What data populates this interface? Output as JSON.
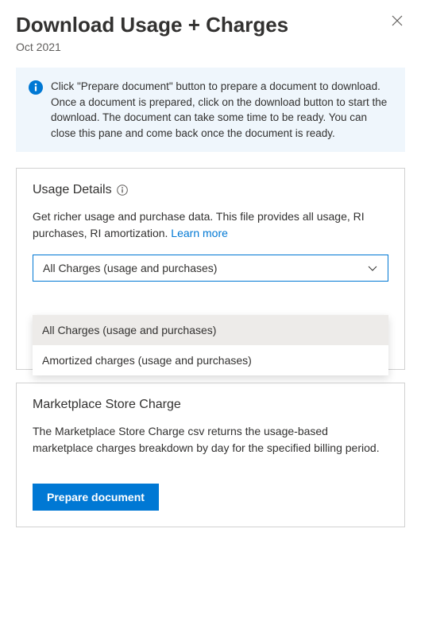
{
  "header": {
    "title": "Download Usage + Charges",
    "subtitle": "Oct 2021"
  },
  "info_banner": {
    "text": "Click \"Prepare document\" button to prepare a document to download. Once a document is prepared, click on the download button to start the download. The document can take some time to be ready. You can close this pane and come back once the document is ready."
  },
  "usage_details": {
    "title": "Usage Details",
    "description": "Get richer usage and purchase data. This file provides all usage, RI purchases, RI amortization. ",
    "learn_more_label": "Learn more",
    "dropdown": {
      "selected": "All Charges (usage and purchases)",
      "options": [
        "All Charges (usage and purchases)",
        "Amortized charges (usage and purchases)"
      ]
    }
  },
  "marketplace": {
    "title": "Marketplace Store Charge",
    "description": "The Marketplace Store Charge csv returns the usage-based marketplace charges breakdown by day for the specified billing period.",
    "button_label": "Prepare document"
  }
}
